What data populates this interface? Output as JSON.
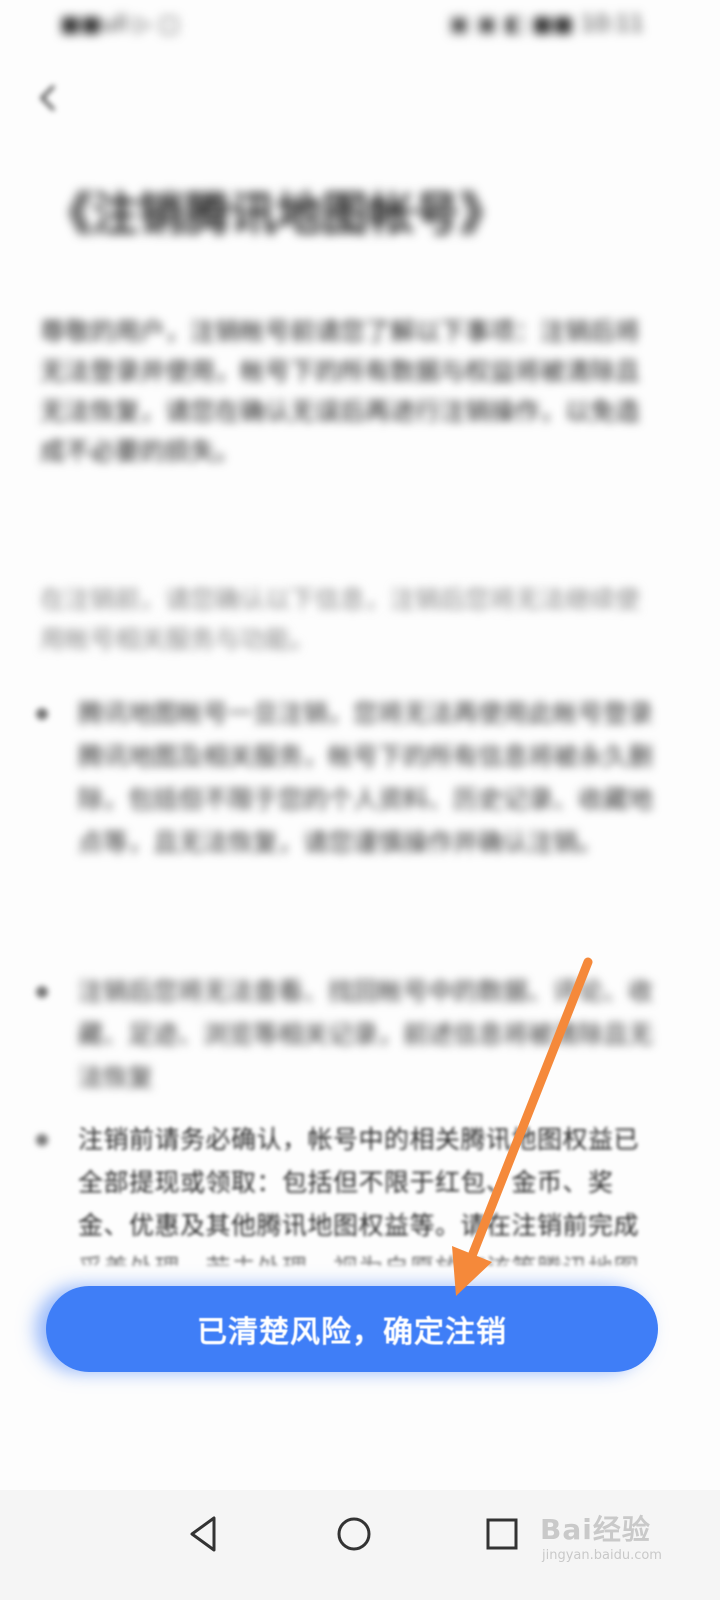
{
  "status_bar": {
    "left": "■■ull ▷ ▢",
    "right": "▣ ▣ ◧ ■■ 10:11"
  },
  "page": {
    "title": "《注销腾讯地图帐号》",
    "intro": "尊敬的用户，注销帐号前请您了解以下事项：注销后将无法登录并使用，帐号下的所有数据与权益将被清除且无法恢复，请您在确认无误后再进行注销操作，以免造成不必要的损失。",
    "notice": "在注销前，请您确认以下信息，注销后您将无法继续使用帐号相关服务与功能。",
    "bullets": [
      "腾讯地图帐号一旦注销，您将无法再使用此帐号登录腾讯地图及相关服务，帐号下的所有信息将被永久删除，包括但不限于您的个人资料、历史记录、收藏地点等，且无法恢复，请您谨慎操作并确认注销。",
      "注销后您将无法查看、找回帐号中的数据、评论、收藏、足迹、浏览等相关记录，前述信息将被清除且无法恢复",
      "注销前请务必确认，帐号中的相关腾讯地图权益已全部提现或领取：包括但不限于红包、金币、奖金、优惠及其他腾讯地图权益等。请在注销前完成妥善处理，若未处理，视为自愿放弃该等腾讯地图权益"
    ]
  },
  "confirm_button": {
    "label": "已清楚风险，确定注销",
    "color": "#3f7ef7"
  },
  "annotation": {
    "arrow_color": "#f5893a"
  },
  "nav_bar": {
    "back_icon": "triangle-back-icon",
    "home_icon": "circle-home-icon",
    "recent_icon": "square-recent-icon"
  },
  "watermark": {
    "main": "Bai经验",
    "sub": "jingyan.baidu.com"
  }
}
